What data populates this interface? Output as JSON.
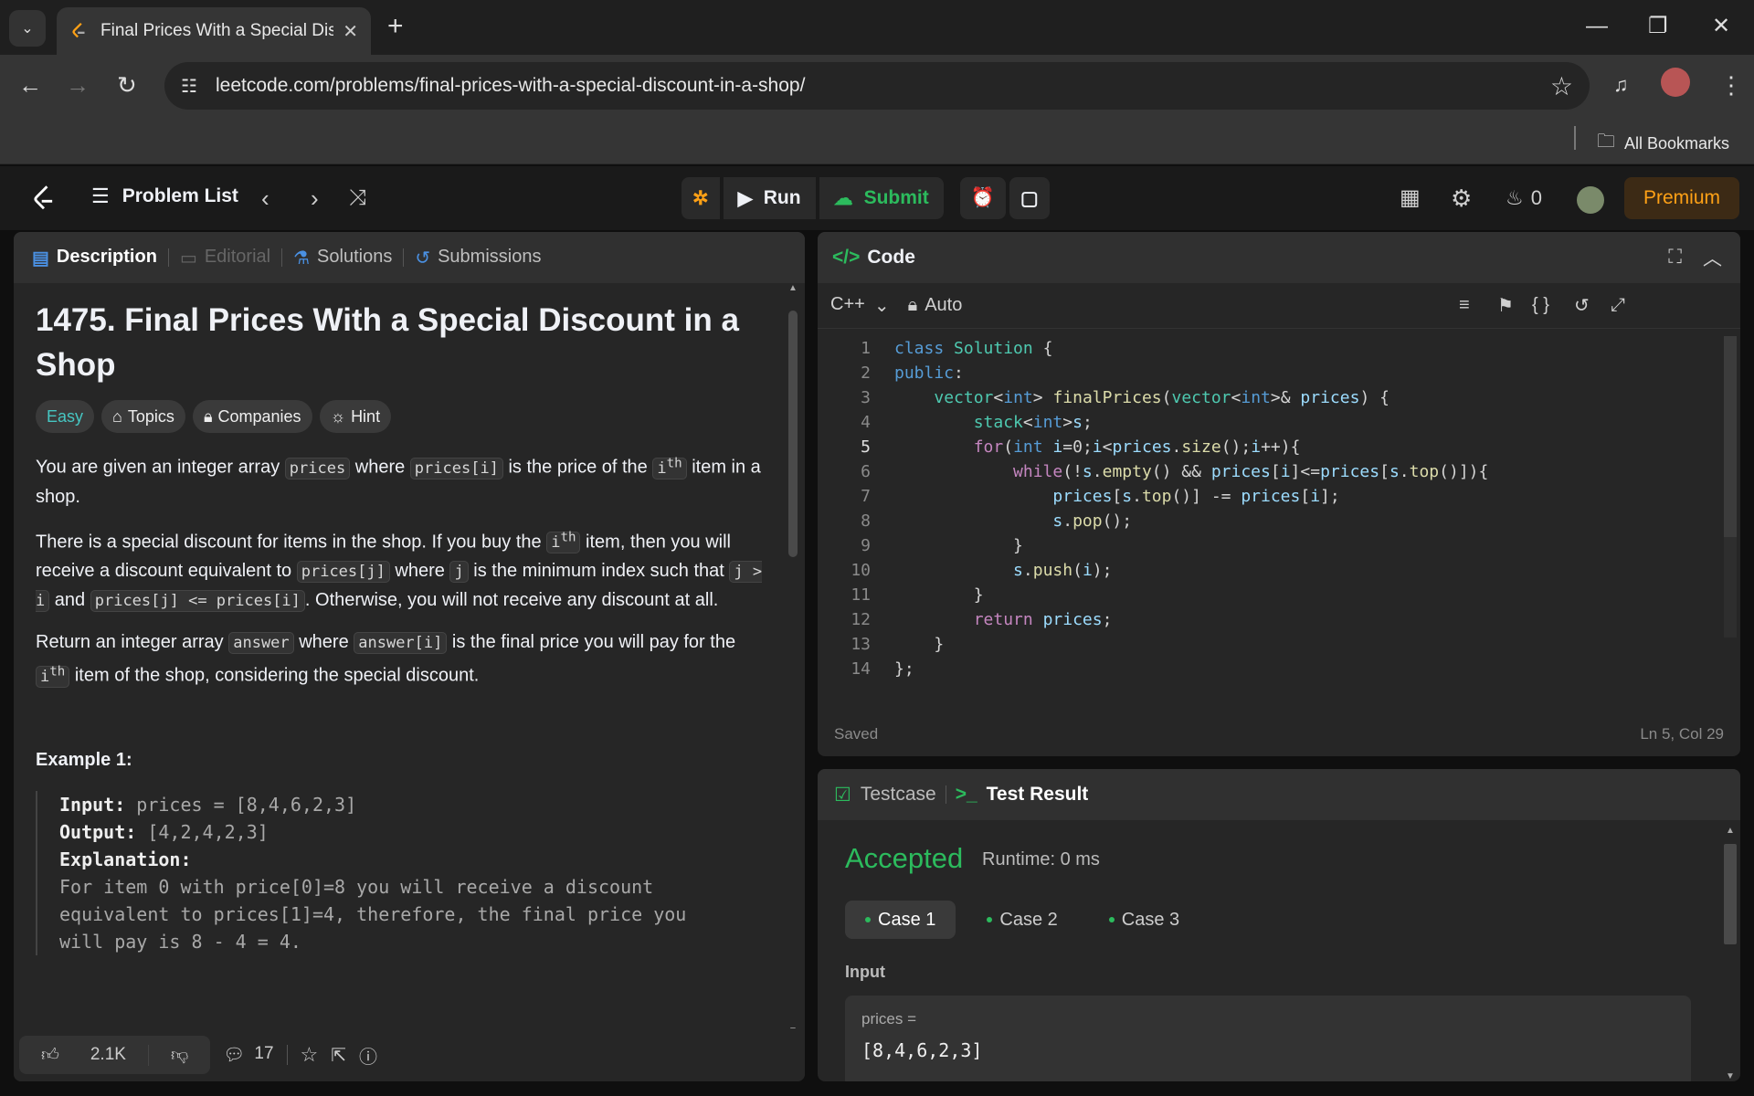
{
  "browser": {
    "tab_title": "Final Prices With a Special Disco",
    "url": "leetcode.com/problems/final-prices-with-a-special-discount-in-a-shop/",
    "bookmarks_label": "All Bookmarks"
  },
  "header": {
    "problem_list": "Problem List",
    "run": "Run",
    "submit": "Submit",
    "streak": "0",
    "premium": "Premium"
  },
  "left": {
    "tabs": [
      "Description",
      "Editorial",
      "Solutions",
      "Submissions"
    ],
    "title": "1475. Final Prices With a Special Discount in a Shop",
    "chips": [
      "Easy",
      "Topics",
      "Companies",
      "Hint"
    ],
    "p1": [
      "You are given an integer array ",
      "prices",
      " where ",
      "prices[i]",
      " is the price of the ",
      "i",
      "th",
      " item in a shop."
    ],
    "p2": [
      "There is a special discount for items in the shop. If you buy the ",
      "i",
      "th",
      " item, then you will receive a discount equivalent to ",
      "prices[j]",
      " where ",
      "j",
      " is the minimum index such that ",
      "j > i",
      " and ",
      "prices[j] <= prices[i]",
      ". Otherwise, you will not receive any discount at all."
    ],
    "p3": [
      "Return an integer array ",
      "answer",
      " where ",
      "answer[i]",
      " is the final price you will pay for the ",
      "i",
      "th",
      " item of the shop, considering the special discount."
    ],
    "example_title": "Example 1:",
    "ex_input_label": "Input:",
    "ex_input": " prices = [8,4,6,2,3]",
    "ex_output_label": "Output:",
    "ex_output": " [4,2,4,2,3]",
    "ex_expl_label": "Explanation:",
    "ex_expl_1": "For item 0 with price[0]=8 you will receive a discount",
    "ex_expl_2": "equivalent to prices[1]=4, therefore, the final price you",
    "ex_expl_3": "will pay is 8 - 4 = 4.",
    "likes": "2.1K",
    "comments": "17"
  },
  "code": {
    "title": "Code",
    "language": "C++",
    "mode": "Auto",
    "saved": "Saved",
    "cursor": "Ln 5, Col 29",
    "active_line": 5,
    "lines": [
      "class Solution {",
      "public:",
      "    vector<int> finalPrices(vector<int>& prices) {",
      "        stack<int>s;",
      "        for(int i=0;i<prices.size();i++){",
      "            while(!s.empty() && prices[i]<=prices[s.top()]){",
      "                prices[s.top()] -= prices[i];",
      "                s.pop();",
      "            }",
      "            s.push(i);",
      "        }",
      "        return prices;",
      "    }",
      "};"
    ]
  },
  "result": {
    "tabs": [
      "Testcase",
      "Test Result"
    ],
    "status": "Accepted",
    "runtime": "Runtime: 0 ms",
    "cases": [
      "Case 1",
      "Case 2",
      "Case 3"
    ],
    "input_label": "Input",
    "var_label": "prices =",
    "var_value": "[8,4,6,2,3]"
  }
}
